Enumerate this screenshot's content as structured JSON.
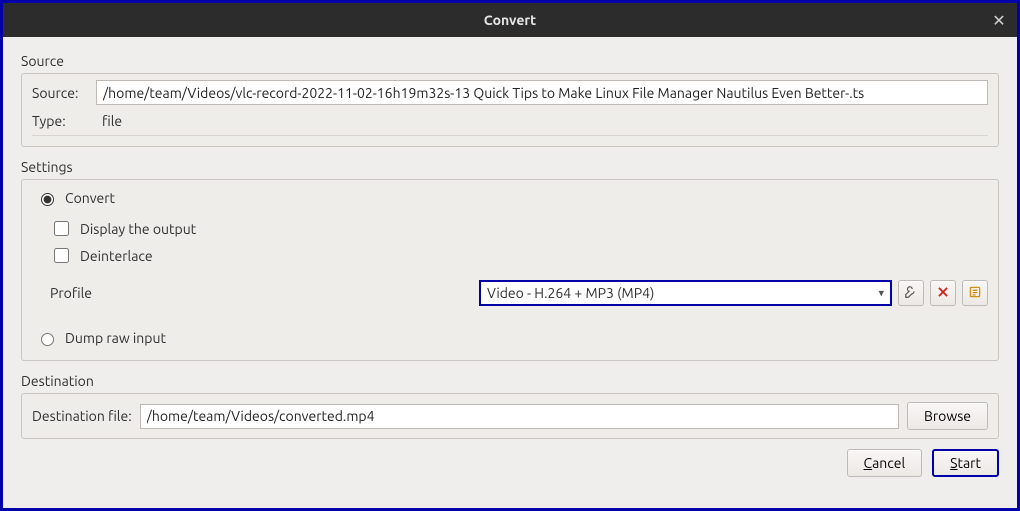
{
  "window": {
    "title": "Convert"
  },
  "source": {
    "section": "Source",
    "label": "Source:",
    "value": "/home/team/Videos/vlc-record-2022-11-02-16h19m32s-13 Quick Tips to Make Linux File Manager Nautilus Even Better-.ts",
    "type_label": "Type:",
    "type_value": "file"
  },
  "settings": {
    "section": "Settings",
    "convert_label": "Convert",
    "display_output_label": "Display the output",
    "deinterlace_label": "Deinterlace",
    "profile_label": "Profile",
    "profile_value": "Video - H.264 + MP3 (MP4)",
    "dump_label": "Dump raw input"
  },
  "destination": {
    "section": "Destination",
    "label": "Destination file:",
    "value": "/home/team/Videos/converted.mp4",
    "browse_label": "Browse"
  },
  "footer": {
    "cancel": "ancel",
    "cancel_mn": "C",
    "start": "tart",
    "start_mn": "S"
  }
}
